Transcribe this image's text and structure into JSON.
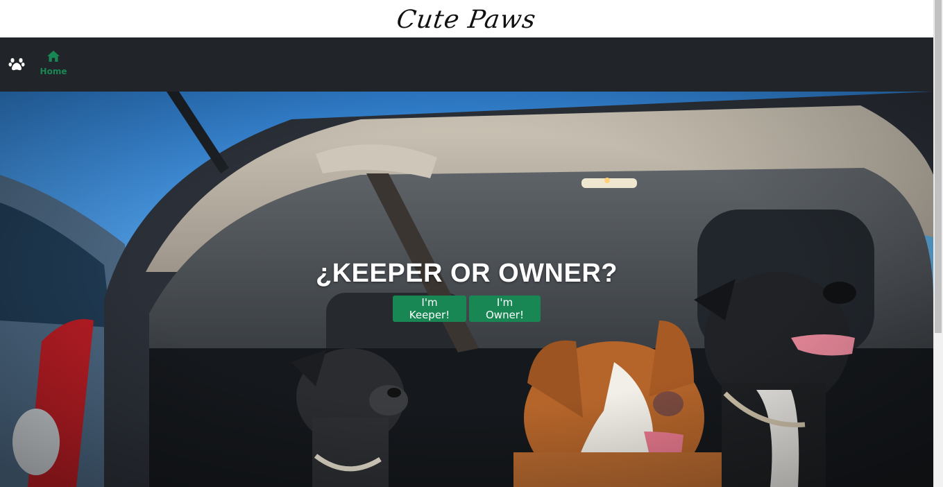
{
  "header": {
    "logo": "Cute Paws"
  },
  "nav": {
    "brand_icon": "paw-icon",
    "items": [
      {
        "label": "Home",
        "icon": "home-icon",
        "active": true
      }
    ]
  },
  "hero": {
    "title": "¿KEEPER OR OWNER?",
    "buttons": {
      "keeper": "I'm Keeper!",
      "owner": "I'm Owner!"
    }
  },
  "colors": {
    "accent": "#198754",
    "navbar": "#212529"
  }
}
